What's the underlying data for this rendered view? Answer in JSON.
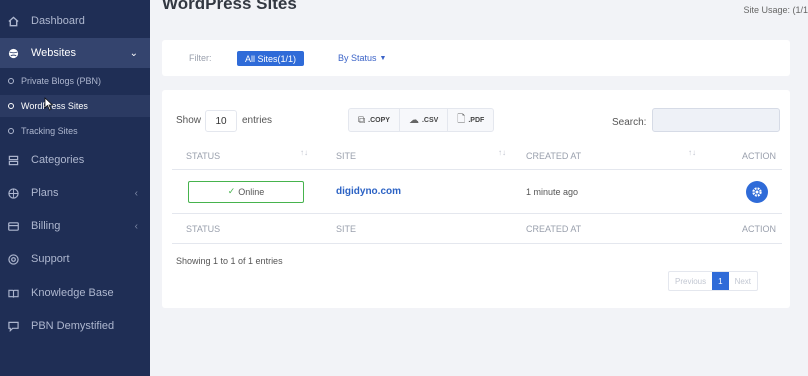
{
  "sidebar": {
    "items": [
      {
        "label": "Dashboard",
        "icon": "home-icon"
      },
      {
        "label": "Websites",
        "icon": "globe-icon"
      },
      {
        "label": "Categories",
        "icon": "list-icon"
      },
      {
        "label": "Plans",
        "icon": "plans-icon"
      },
      {
        "label": "Billing",
        "icon": "card-icon"
      },
      {
        "label": "Support",
        "icon": "support-icon"
      },
      {
        "label": "Knowledge Base",
        "icon": "book-icon"
      },
      {
        "label": "PBN Demystified",
        "icon": "chat-icon"
      }
    ],
    "subitems": [
      {
        "label": "Private Blogs (PBN)"
      },
      {
        "label": "WordPress Sites"
      },
      {
        "label": "Tracking Sites"
      }
    ]
  },
  "header": {
    "title": "WordPress Sites",
    "usage": "Site Usage: (1/1"
  },
  "filter": {
    "label": "Filter:",
    "all_sites": "All Sites(1/1)",
    "by_status": "By Status"
  },
  "table": {
    "show_label": "Show",
    "length_value": "10",
    "entries_label": "entries",
    "exports": [
      ".COPY",
      ".CSV",
      ".PDF"
    ],
    "search_label": "Search:",
    "search_value": "",
    "columns": [
      "STATUS",
      "SITE",
      "CREATED AT",
      "ACTION"
    ],
    "rows": [
      {
        "status": "Online",
        "site": "digidyno.com",
        "created": "1 minute ago"
      }
    ],
    "info": "Showing 1 to 1 of 1 entries",
    "pagination": {
      "previous": "Previous",
      "current": "1",
      "next": "Next"
    }
  },
  "colors": {
    "sidebar_bg": "#1f2e55",
    "accent": "#2f6bd8",
    "online": "#46b34d"
  }
}
